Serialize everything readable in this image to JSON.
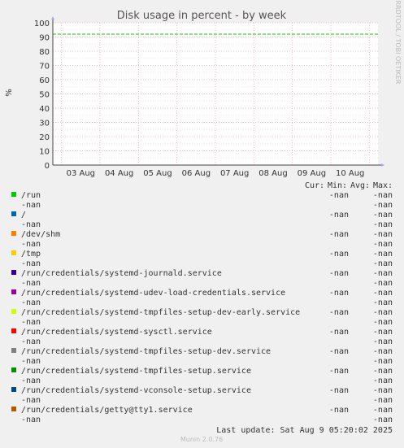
{
  "chart_data": {
    "type": "line",
    "title": "Disk usage in percent - by week",
    "ylabel": "%",
    "xlabel": "",
    "ylim": [
      0,
      100
    ],
    "y_ticks": [
      0,
      10,
      20,
      30,
      40,
      50,
      60,
      70,
      80,
      90,
      100
    ],
    "x_ticks": [
      "03 Aug",
      "04 Aug",
      "05 Aug",
      "06 Aug",
      "07 Aug",
      "08 Aug",
      "09 Aug",
      "10 Aug"
    ],
    "grid": true,
    "series": [
      {
        "name": "/run",
        "color": "#00cc00",
        "values": [
          92,
          92,
          92,
          92,
          92,
          92,
          92,
          92,
          92
        ]
      }
    ]
  },
  "side_label": "RRDTOOL / TOBI OETIKER",
  "legend_header": {
    "cur": "Cur:",
    "min": "Min:",
    "avg": "Avg:",
    "max": "Max:"
  },
  "legend": [
    {
      "name": "/run",
      "color": "#00cc00",
      "cur": "-nan",
      "min": "-nan",
      "avg": "-nan",
      "max": "-nan"
    },
    {
      "name": "/",
      "color": "#0066b3",
      "cur": "-nan",
      "min": "-nan",
      "avg": "-nan",
      "max": "-nan"
    },
    {
      "name": "/dev/shm",
      "color": "#ff8000",
      "cur": "-nan",
      "min": "-nan",
      "avg": "-nan",
      "max": "-nan"
    },
    {
      "name": "/tmp",
      "color": "#ffcc00",
      "cur": "-nan",
      "min": "-nan",
      "avg": "-nan",
      "max": "-nan"
    },
    {
      "name": "/run/credentials/systemd-journald.service",
      "color": "#330099",
      "cur": "-nan",
      "min": "-nan",
      "avg": "-nan",
      "max": "-nan"
    },
    {
      "name": "/run/credentials/systemd-udev-load-credentials.service",
      "color": "#990099",
      "cur": "-nan",
      "min": "-nan",
      "avg": "-nan",
      "max": "-nan"
    },
    {
      "name": "/run/credentials/systemd-tmpfiles-setup-dev-early.service",
      "color": "#ccff00",
      "cur": "-nan",
      "min": "-nan",
      "avg": "-nan",
      "max": "-nan"
    },
    {
      "name": "/run/credentials/systemd-sysctl.service",
      "color": "#ff0000",
      "cur": "-nan",
      "min": "-nan",
      "avg": "-nan",
      "max": "-nan"
    },
    {
      "name": "/run/credentials/systemd-tmpfiles-setup-dev.service",
      "color": "#808080",
      "cur": "-nan",
      "min": "-nan",
      "avg": "-nan",
      "max": "-nan"
    },
    {
      "name": "/run/credentials/systemd-tmpfiles-setup.service",
      "color": "#008f00",
      "cur": "-nan",
      "min": "-nan",
      "avg": "-nan",
      "max": "-nan"
    },
    {
      "name": "/run/credentials/systemd-vconsole-setup.service",
      "color": "#00487d",
      "cur": "-nan",
      "min": "-nan",
      "avg": "-nan",
      "max": "-nan"
    },
    {
      "name": "/run/credentials/getty@tty1.service",
      "color": "#b35a00",
      "cur": "-nan",
      "min": "-nan",
      "avg": "-nan",
      "max": "-nan"
    }
  ],
  "last_update": "Last update: Sat Aug  9 05:20:02 2025",
  "footer": "Munin 2.0.76"
}
